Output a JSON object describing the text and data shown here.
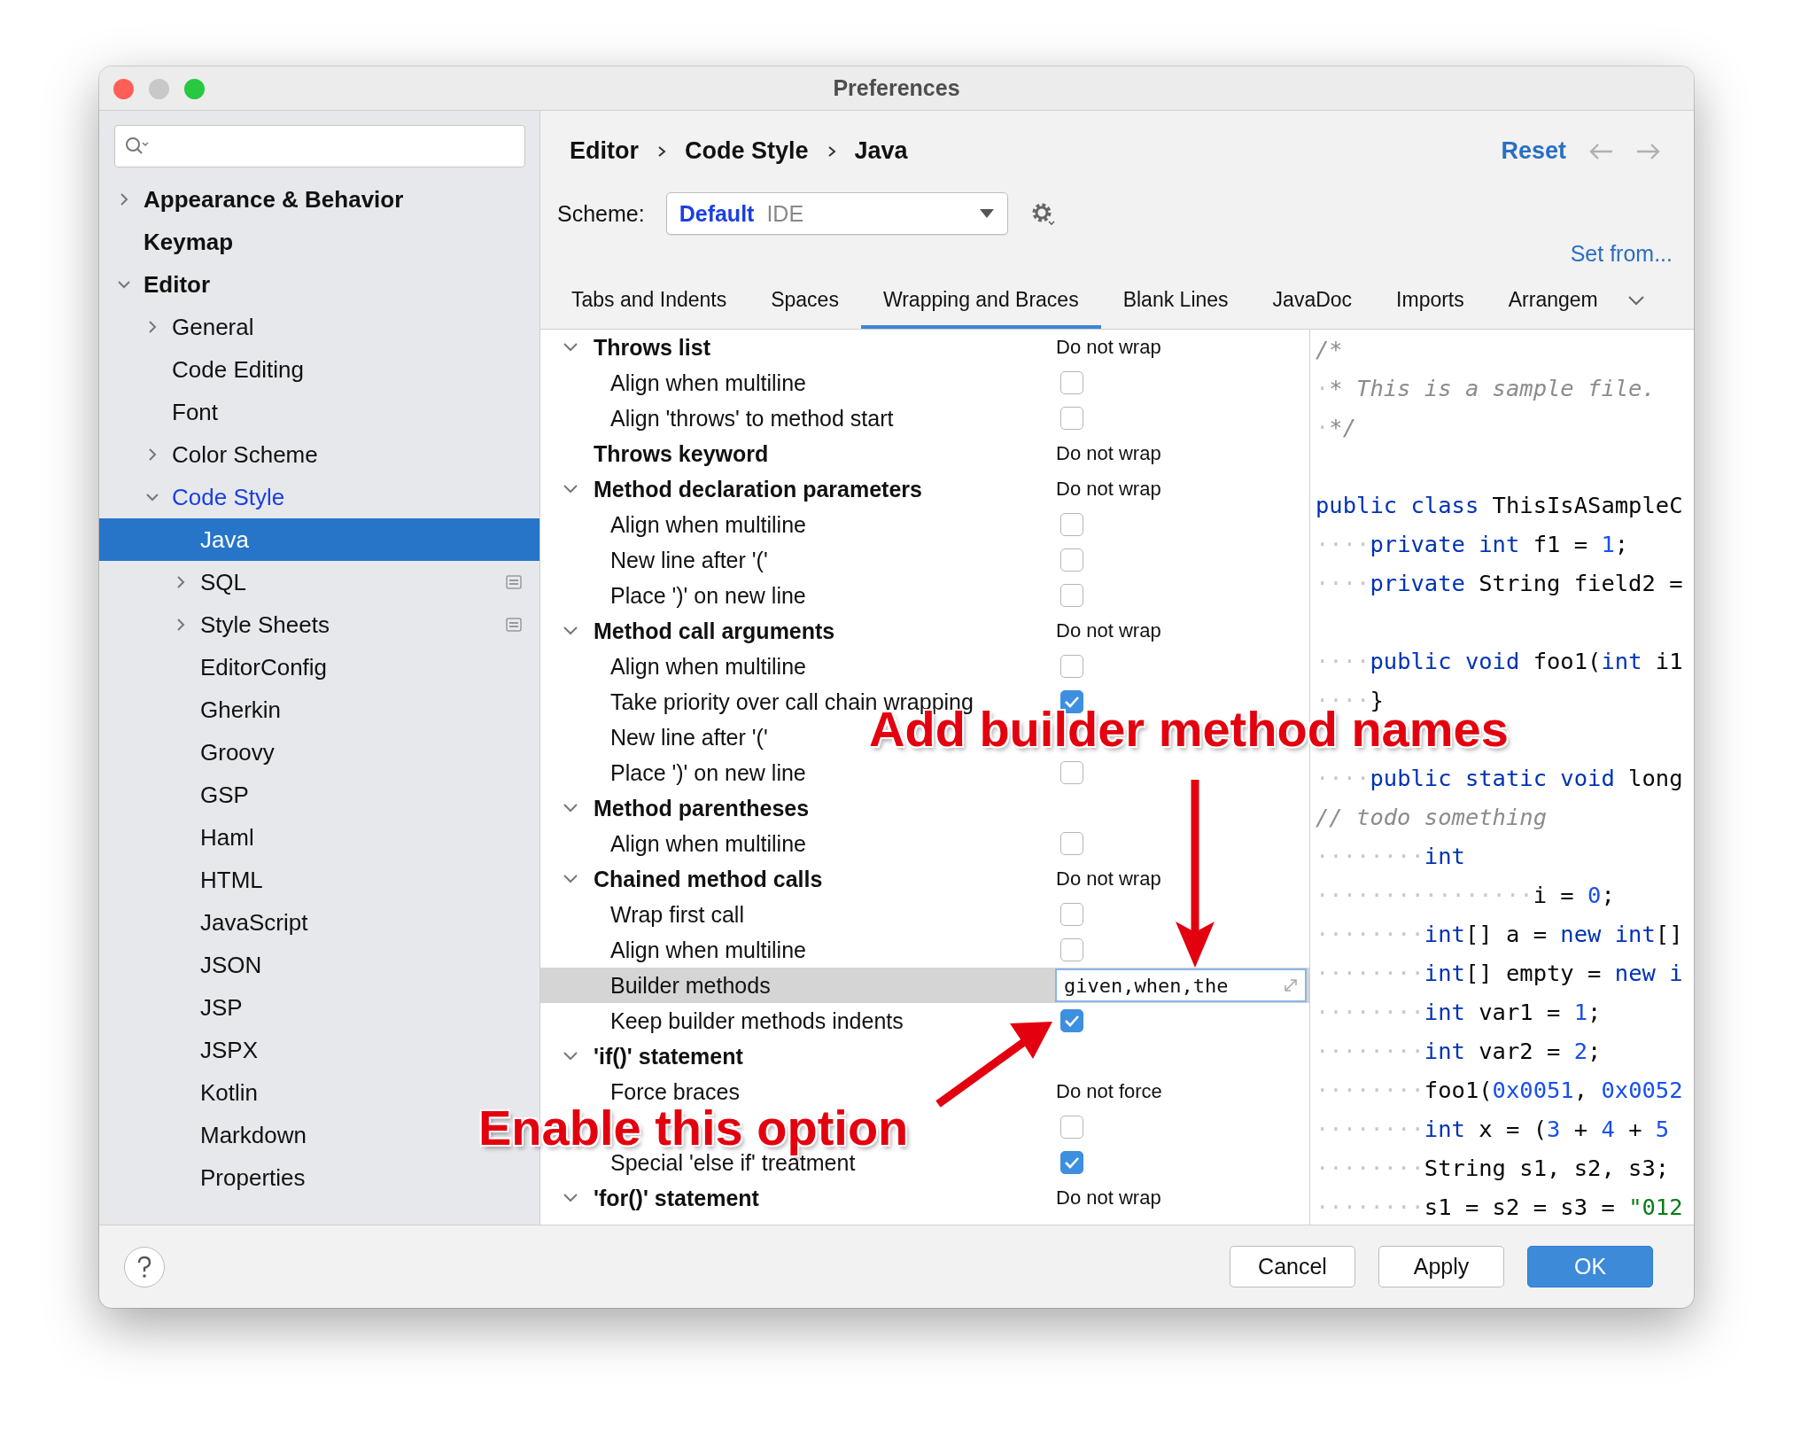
{
  "window": {
    "title": "Preferences"
  },
  "sidebar": {
    "items": [
      {
        "label": "Appearance & Behavior",
        "expanded": false,
        "selected": false,
        "modified": false
      },
      {
        "label": "Keymap",
        "selected": false,
        "modified": false
      },
      {
        "label": "Editor",
        "expanded": true,
        "selected": false,
        "modified": false,
        "children": [
          {
            "label": "General",
            "expanded": false,
            "selected": false,
            "modified": false
          },
          {
            "label": "Code Editing",
            "selected": false,
            "modified": false
          },
          {
            "label": "Font",
            "selected": false,
            "modified": false
          },
          {
            "label": "Color Scheme",
            "expanded": false,
            "selected": false,
            "modified": false
          },
          {
            "label": "Code Style",
            "expanded": true,
            "selected": false,
            "modified": true,
            "children": [
              {
                "label": "Java",
                "selected": true,
                "modified": false
              },
              {
                "label": "SQL",
                "expanded": false,
                "selected": false,
                "modified": false,
                "scheme_icon": true
              },
              {
                "label": "Style Sheets",
                "expanded": false,
                "selected": false,
                "modified": false,
                "scheme_icon": true
              },
              {
                "label": "EditorConfig",
                "selected": false,
                "modified": false
              },
              {
                "label": "Gherkin",
                "selected": false,
                "modified": false
              },
              {
                "label": "Groovy",
                "selected": false,
                "modified": false
              },
              {
                "label": "GSP",
                "selected": false,
                "modified": false
              },
              {
                "label": "Haml",
                "selected": false,
                "modified": false
              },
              {
                "label": "HTML",
                "selected": false,
                "modified": false
              },
              {
                "label": "JavaScript",
                "selected": false,
                "modified": false
              },
              {
                "label": "JSON",
                "selected": false,
                "modified": false
              },
              {
                "label": "JSP",
                "selected": false,
                "modified": false
              },
              {
                "label": "JSPX",
                "selected": false,
                "modified": false
              },
              {
                "label": "Kotlin",
                "selected": false,
                "modified": false
              },
              {
                "label": "Markdown",
                "selected": false,
                "modified": false
              },
              {
                "label": "Properties",
                "selected": false,
                "modified": false
              }
            ]
          }
        ]
      }
    ]
  },
  "breadcrumb": [
    "Editor",
    "Code Style",
    "Java"
  ],
  "header": {
    "reset": "Reset",
    "set_from": "Set from..."
  },
  "scheme": {
    "label": "Scheme:",
    "name": "Default",
    "type": "IDE"
  },
  "tabs": [
    {
      "label": "Tabs and Indents",
      "selected": false
    },
    {
      "label": "Spaces",
      "selected": false
    },
    {
      "label": "Wrapping and Braces",
      "selected": true
    },
    {
      "label": "Blank Lines",
      "selected": false
    },
    {
      "label": "JavaDoc",
      "selected": false
    },
    {
      "label": "Imports",
      "selected": false
    },
    {
      "label": "Arrangem",
      "selected": false
    }
  ],
  "options": [
    {
      "kind": "group",
      "label": "Throws list",
      "expanded": true,
      "value": "Do not wrap",
      "selected": false
    },
    {
      "kind": "checkbox",
      "label": "Align when multiline",
      "checked": false,
      "selected": false
    },
    {
      "kind": "checkbox",
      "label": "Align 'throws' to method start",
      "checked": false,
      "selected": false
    },
    {
      "kind": "group",
      "label": "Throws keyword",
      "value": "Do not wrap",
      "selected": false
    },
    {
      "kind": "group",
      "label": "Method declaration parameters",
      "expanded": true,
      "value": "Do not wrap",
      "selected": false
    },
    {
      "kind": "checkbox",
      "label": "Align when multiline",
      "checked": false,
      "selected": false
    },
    {
      "kind": "checkbox",
      "label": "New line after '('",
      "checked": false,
      "selected": false
    },
    {
      "kind": "checkbox",
      "label": "Place ')' on new line",
      "checked": false,
      "selected": false
    },
    {
      "kind": "group",
      "label": "Method call arguments",
      "expanded": true,
      "value": "Do not wrap",
      "selected": false
    },
    {
      "kind": "checkbox",
      "label": "Align when multiline",
      "checked": false,
      "selected": false
    },
    {
      "kind": "checkbox",
      "label": "Take priority over call chain wrapping",
      "checked": true,
      "selected": false
    },
    {
      "kind": "label",
      "label": "New line after '('",
      "selected": false
    },
    {
      "kind": "checkbox",
      "label": "Place ')' on new line",
      "checked": false,
      "selected": false
    },
    {
      "kind": "group",
      "label": "Method parentheses",
      "expanded": true,
      "selected": false
    },
    {
      "kind": "checkbox",
      "label": "Align when multiline",
      "checked": false,
      "selected": false
    },
    {
      "kind": "group",
      "label": "Chained method calls",
      "expanded": true,
      "value": "Do not wrap",
      "selected": false
    },
    {
      "kind": "checkbox",
      "label": "Wrap first call",
      "checked": false,
      "selected": false
    },
    {
      "kind": "checkbox",
      "label": "Align when multiline",
      "checked": false,
      "selected": false
    },
    {
      "kind": "field",
      "label": "Builder methods",
      "value": "given,when,the",
      "selected": true
    },
    {
      "kind": "checkbox",
      "label": "Keep builder methods indents",
      "checked": true,
      "selected": false
    },
    {
      "kind": "group",
      "label": "'if()' statement",
      "expanded": true,
      "selected": false
    },
    {
      "kind": "value",
      "label": "Force braces",
      "value": "Do not force",
      "selected": false
    },
    {
      "kind": "checkbox",
      "checked": false,
      "selected": false
    },
    {
      "kind": "checkbox",
      "label": "Special 'else if' treatment",
      "checked": true,
      "selected": false
    },
    {
      "kind": "group",
      "label": "'for()' statement",
      "expanded": true,
      "value": "Do not wrap",
      "selected": false
    }
  ],
  "preview": {
    "lines": [
      {
        "kind": "code",
        "tokens": [
          {
            "kind": "comment",
            "text": "/*"
          }
        ]
      },
      {
        "kind": "code",
        "tokens": [
          {
            "kind": "space",
            "text": "·"
          },
          {
            "kind": "comment",
            "text": "* This is a sample file."
          }
        ]
      },
      {
        "kind": "code",
        "tokens": [
          {
            "kind": "space",
            "text": "·"
          },
          {
            "kind": "comment",
            "text": "*/"
          }
        ]
      },
      {
        "kind": "blank"
      },
      {
        "kind": "code",
        "tokens": [
          {
            "kind": "keyword",
            "text": "public class"
          },
          {
            "kind": "plain",
            "text": " ThisIsASampleC"
          }
        ]
      },
      {
        "kind": "code",
        "tokens": [
          {
            "kind": "space",
            "text": "····"
          },
          {
            "kind": "keyword",
            "text": "private int"
          },
          {
            "kind": "plain",
            "text": " f1 = "
          },
          {
            "kind": "number",
            "text": "1"
          },
          {
            "kind": "plain",
            "text": ";"
          }
        ]
      },
      {
        "kind": "code",
        "tokens": [
          {
            "kind": "space",
            "text": "····"
          },
          {
            "kind": "keyword",
            "text": "private"
          },
          {
            "kind": "plain",
            "text": " String field2 ="
          }
        ]
      },
      {
        "kind": "blank"
      },
      {
        "kind": "code",
        "tokens": [
          {
            "kind": "space",
            "text": "····"
          },
          {
            "kind": "keyword",
            "text": "public void"
          },
          {
            "kind": "plain",
            "text": " foo1("
          },
          {
            "kind": "keyword",
            "text": "int"
          },
          {
            "kind": "plain",
            "text": " i1"
          }
        ]
      },
      {
        "kind": "code",
        "tokens": [
          {
            "kind": "space",
            "text": "····"
          },
          {
            "kind": "plain",
            "text": "}"
          }
        ]
      },
      {
        "kind": "blank"
      },
      {
        "kind": "code",
        "tokens": [
          {
            "kind": "space",
            "text": "····"
          },
          {
            "kind": "keyword",
            "text": "public static void"
          },
          {
            "kind": "plain",
            "text": " long"
          }
        ]
      },
      {
        "kind": "code",
        "tokens": [
          {
            "kind": "comment",
            "text": "// todo something"
          }
        ]
      },
      {
        "kind": "code",
        "tokens": [
          {
            "kind": "space",
            "text": "········"
          },
          {
            "kind": "keyword",
            "text": "int"
          }
        ]
      },
      {
        "kind": "code",
        "tokens": [
          {
            "kind": "space",
            "text": "················"
          },
          {
            "kind": "plain",
            "text": "i = "
          },
          {
            "kind": "number",
            "text": "0"
          },
          {
            "kind": "plain",
            "text": ";"
          }
        ]
      },
      {
        "kind": "code",
        "tokens": [
          {
            "kind": "space",
            "text": "········"
          },
          {
            "kind": "keyword",
            "text": "int"
          },
          {
            "kind": "plain",
            "text": "[] a = "
          },
          {
            "kind": "keyword",
            "text": "new int"
          },
          {
            "kind": "plain",
            "text": "[]"
          }
        ]
      },
      {
        "kind": "code",
        "tokens": [
          {
            "kind": "space",
            "text": "········"
          },
          {
            "kind": "keyword",
            "text": "int"
          },
          {
            "kind": "plain",
            "text": "[] empty = "
          },
          {
            "kind": "keyword",
            "text": "new i"
          }
        ]
      },
      {
        "kind": "code",
        "tokens": [
          {
            "kind": "space",
            "text": "········"
          },
          {
            "kind": "keyword",
            "text": "int"
          },
          {
            "kind": "plain",
            "text": " var1 = "
          },
          {
            "kind": "number",
            "text": "1"
          },
          {
            "kind": "plain",
            "text": ";"
          }
        ]
      },
      {
        "kind": "code",
        "tokens": [
          {
            "kind": "space",
            "text": "········"
          },
          {
            "kind": "keyword",
            "text": "int"
          },
          {
            "kind": "plain",
            "text": " var2 = "
          },
          {
            "kind": "number",
            "text": "2"
          },
          {
            "kind": "plain",
            "text": ";"
          }
        ]
      },
      {
        "kind": "code",
        "tokens": [
          {
            "kind": "space",
            "text": "········"
          },
          {
            "kind": "plain",
            "text": "foo1("
          },
          {
            "kind": "number",
            "text": "0x0051"
          },
          {
            "kind": "plain",
            "text": ", "
          },
          {
            "kind": "number",
            "text": "0x0052"
          }
        ]
      },
      {
        "kind": "code",
        "tokens": [
          {
            "kind": "space",
            "text": "········"
          },
          {
            "kind": "keyword",
            "text": "int"
          },
          {
            "kind": "plain",
            "text": " x = ("
          },
          {
            "kind": "number",
            "text": "3"
          },
          {
            "kind": "plain",
            "text": " + "
          },
          {
            "kind": "number",
            "text": "4"
          },
          {
            "kind": "plain",
            "text": " + "
          },
          {
            "kind": "number",
            "text": "5"
          }
        ]
      },
      {
        "kind": "code",
        "tokens": [
          {
            "kind": "space",
            "text": "········"
          },
          {
            "kind": "plain",
            "text": "String s1, s2, s3;"
          }
        ]
      },
      {
        "kind": "code",
        "tokens": [
          {
            "kind": "space",
            "text": "········"
          },
          {
            "kind": "plain",
            "text": "s1 = s2 = s3 = "
          },
          {
            "kind": "string",
            "text": "\"012"
          }
        ]
      }
    ]
  },
  "buttons": [
    {
      "label": "Cancel",
      "primary": false
    },
    {
      "label": "Apply",
      "primary": false
    },
    {
      "label": "OK",
      "primary": true
    }
  ],
  "annotations": [
    {
      "kind": "down",
      "text": "Add builder method names"
    },
    {
      "kind": "up-right",
      "text": "Enable this option"
    }
  ]
}
